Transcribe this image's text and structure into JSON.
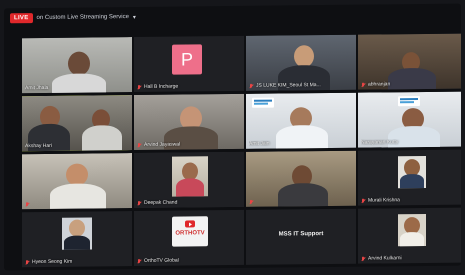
{
  "live": {
    "badge": "LIVE",
    "title": "on Custom Live Streaming Service"
  },
  "tiles": [
    {
      "name": "Amit Jhala",
      "muted": false
    },
    {
      "name": "Hall B Incharge",
      "muted": true,
      "avatar_letter": "P"
    },
    {
      "name": "JS LUKE KIM_Seoul St Ma...",
      "muted": true
    },
    {
      "name": "abhranjan",
      "muted": true
    },
    {
      "name": "Akshay Hari",
      "muted": false,
      "active": true
    },
    {
      "name": "Arvind Jayaswal",
      "muted": true
    },
    {
      "name": "Amit Jain",
      "muted": false
    },
    {
      "name": "Narayanan Kutty",
      "muted": false
    },
    {
      "name": "",
      "muted": true
    },
    {
      "name": "Deepak Chand",
      "muted": true
    },
    {
      "name": "",
      "muted": true
    },
    {
      "name": "Murali Krishna",
      "muted": true
    },
    {
      "name": "Hyeon Seong Kim",
      "muted": true
    },
    {
      "name": "OrthoTV Global",
      "muted": true,
      "logo_text": "ORTHOTV"
    },
    {
      "name": "MSS IT Support",
      "muted": false,
      "center_text": "MSS IT Support"
    },
    {
      "name": "Arvind Kulkarni",
      "muted": true
    }
  ]
}
